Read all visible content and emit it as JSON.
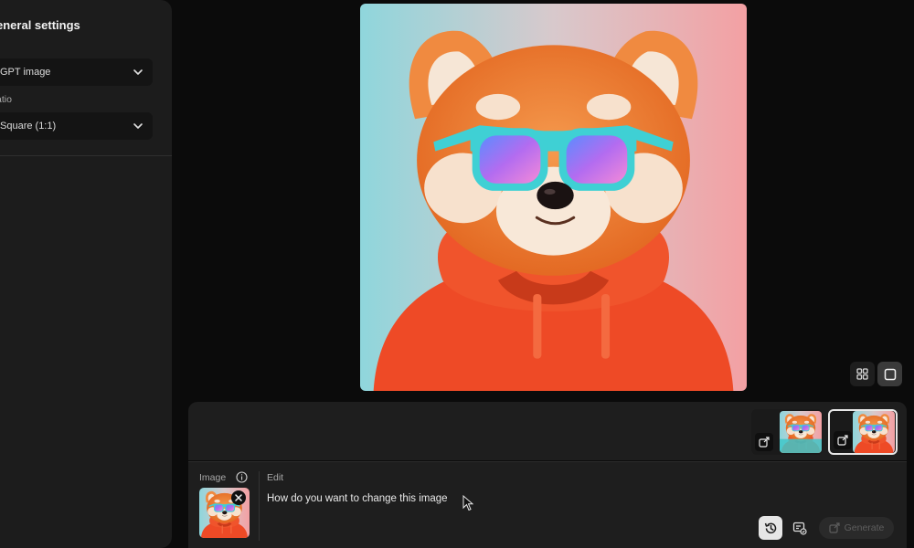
{
  "settings": {
    "title": "eneral settings",
    "model_value": "GPT image",
    "ratio_label": "atio",
    "ratio_value": "Square (1:1)"
  },
  "prompt": {
    "image_label": "Image",
    "edit_label": "Edit",
    "placeholder": "How do you want to change this image"
  },
  "actions": {
    "generate_label": "Generate"
  },
  "icons": [
    "chevron-down-icon",
    "grid-view-icon",
    "single-view-icon",
    "image-edit-icon",
    "info-icon",
    "close-icon",
    "history-icon",
    "style-reference-icon",
    "generate-icon",
    "mouse-cursor-icon"
  ],
  "colors": {
    "background": "#0b0b0b",
    "panel": "#1c1c1c",
    "hoodie": "#f0502d",
    "glasses_frame": "#3fd0d4",
    "fur": "#ef7b33",
    "thumb_hoodie_alt": "#3fc7c9"
  }
}
